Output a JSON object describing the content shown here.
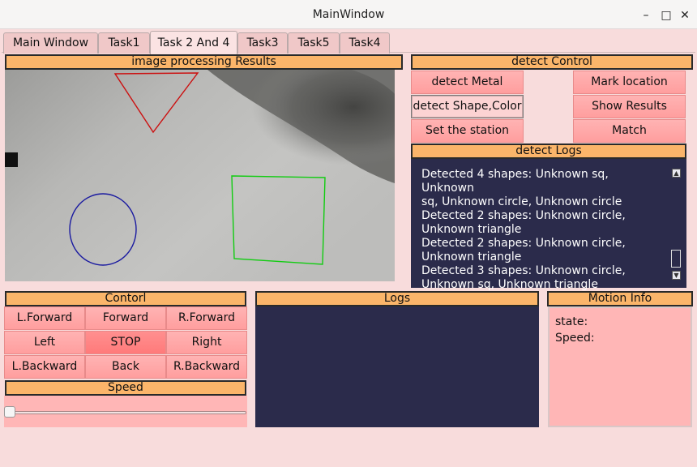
{
  "window": {
    "title": "MainWindow"
  },
  "tabs": [
    {
      "label": "Main Window"
    },
    {
      "label": "Task1"
    },
    {
      "label": "Task 2 And 4"
    },
    {
      "label": "Task3"
    },
    {
      "label": "Task5"
    },
    {
      "label": "Task4"
    }
  ],
  "image_panel": {
    "header": "image processing Results"
  },
  "detect_control": {
    "header": "detect Control",
    "detect_metal": "detect Metal",
    "mark_location": "Mark location",
    "detect_shape_color": "detect Shape,Color",
    "show_results": "Show Results",
    "set_station": "Set the station",
    "match": "Match"
  },
  "detect_logs": {
    "header": "detect Logs",
    "lines": [
      "Detected 4 shapes: Unknown sq, Unknown",
      "sq, Unknown circle, Unknown circle",
      "Detected 2 shapes: Unknown circle,",
      "Unknown triangle",
      "Detected 2 shapes: Unknown circle,",
      "Unknown triangle",
      "Detected 3 shapes: Unknown circle,",
      "Unknown sq, Unknown triangle"
    ]
  },
  "control": {
    "header": "Contorl",
    "l_forward": "L.Forward",
    "forward": "Forward",
    "r_forward": "R.Forward",
    "left": "Left",
    "stop": "STOP",
    "right": "Right",
    "l_backward": "L.Backward",
    "back": "Back",
    "r_backward": "R.Backward"
  },
  "speed": {
    "header": "Speed",
    "value": 0
  },
  "logs": {
    "header": "Logs"
  },
  "motion_info": {
    "header": "Motion Info",
    "state_label": "state:",
    "speed_label": "Speed:"
  },
  "colors": {
    "header_bg": "#fbb56a",
    "button_bg": "#ff9e9e",
    "stop_bg": "#ff7a7a",
    "log_bg": "#2b2b4b",
    "window_bg": "#f8dcdc",
    "triangle": "#cc1111",
    "square": "#11cc11",
    "circle": "#1a1aa0"
  },
  "icons": {
    "minimize": "minimize-icon",
    "maximize": "maximize-icon",
    "close": "close-icon"
  }
}
